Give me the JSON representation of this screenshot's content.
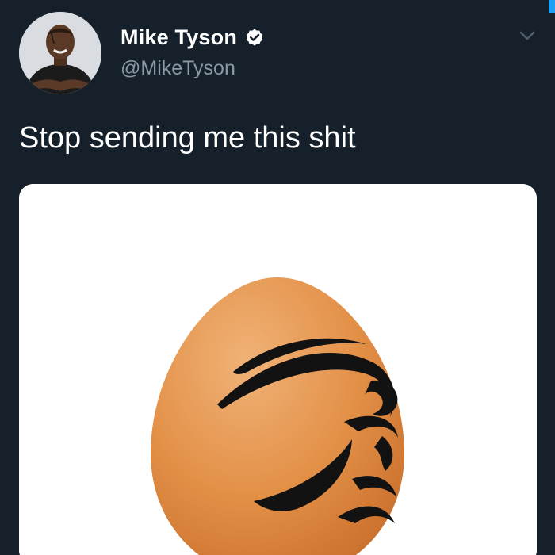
{
  "tweet": {
    "author": {
      "display_name": "Mike Tyson",
      "handle": "@MikeTyson",
      "verified": true
    },
    "text": "Stop sending me this shit",
    "media": {
      "subject": "egg with tribal tattoo"
    }
  },
  "icons": {
    "verified": "verified-badge-icon",
    "more": "chevron-down-icon"
  },
  "colors": {
    "background": "#15202b",
    "text": "#ffffff",
    "secondary_text": "#8b98a5",
    "egg": "#e0904a",
    "tattoo": "#111111"
  }
}
